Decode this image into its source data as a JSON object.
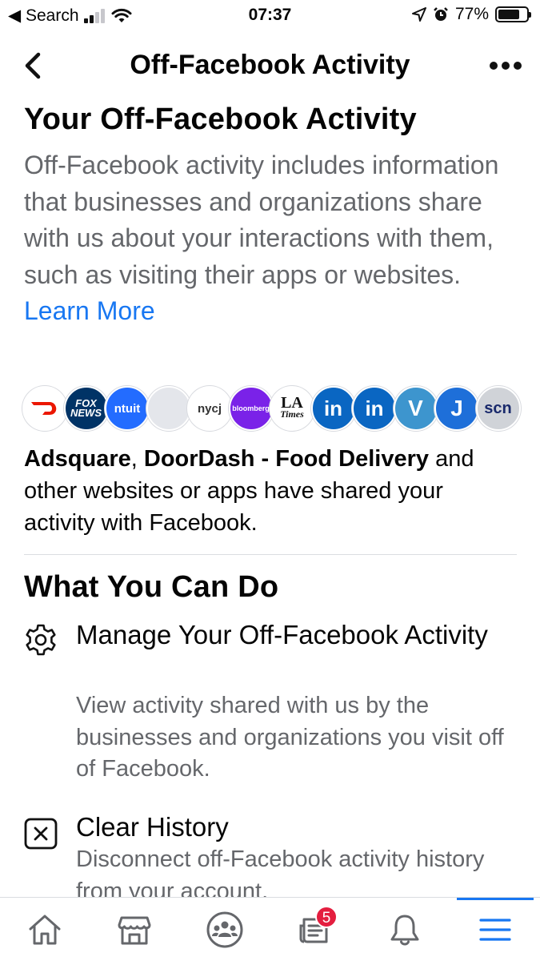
{
  "status_bar": {
    "carrier": "◀ Search",
    "time": "07:37",
    "battery_percent": "77%",
    "battery_level": 0.77
  },
  "nav": {
    "title": "Off-Facebook Activity"
  },
  "summary": {
    "title": "Your Off-Facebook Activity",
    "intro": "Off-Facebook activity includes information that businesses and organizations share with us about your interactions with them, such as visiting their apps or websites.",
    "learn_more": "Learn More",
    "logos": [
      {
        "name": "doordash-logo",
        "label": "",
        "bg": "#ffffff",
        "fg": "#eb1700"
      },
      {
        "name": "fox-news-logo",
        "label": "FOX NEWS",
        "bg": "#003366",
        "fg": "#ffffff"
      },
      {
        "name": "intuit-logo",
        "label": "ntuit",
        "bg": "#236cff",
        "fg": "#ffffff"
      },
      {
        "name": "blank-logo",
        "label": "",
        "bg": "#e4e6eb",
        "fg": "#e4e6eb"
      },
      {
        "name": "nycj-logo",
        "label": "nycj",
        "bg": "#ffffff",
        "fg": "#333333"
      },
      {
        "name": "bloomberg-logo",
        "label": "bloomberg",
        "bg": "#7a22e8",
        "fg": "#ffffff"
      },
      {
        "name": "la-times-logo",
        "label": "LA Times",
        "bg": "#ffffff",
        "fg": "#111111"
      },
      {
        "name": "linkedin-logo-1",
        "label": "in",
        "bg": "#0a66c2",
        "fg": "#ffffff"
      },
      {
        "name": "linkedin-logo-2",
        "label": "in",
        "bg": "#0a66c2",
        "fg": "#ffffff"
      },
      {
        "name": "venmo-logo",
        "label": "V",
        "bg": "#3d95ce",
        "fg": "#ffffff"
      },
      {
        "name": "j-logo",
        "label": "J",
        "bg": "#1e6fd9",
        "fg": "#ffffff"
      },
      {
        "name": "scan-logo",
        "label": "scn",
        "bg": "#d0d3d8",
        "fg": "#1a2a6c"
      }
    ],
    "shared_bold_1": "Adsquare",
    "shared_sep": ", ",
    "shared_bold_2": "DoorDash - Food Delivery",
    "shared_rest": " and other websites or apps have shared your activity with Facebook."
  },
  "actions_section": {
    "title": "What You Can Do",
    "items": [
      {
        "icon": "gear-icon",
        "title": "Manage Your Off-Facebook Activity",
        "description": "View activity shared with us by the businesses and organizations you visit off of Facebook."
      },
      {
        "icon": "close-box-icon",
        "title": "Clear History",
        "description": "Disconnect off-Facebook activity history from your account."
      }
    ]
  },
  "tab_bar": {
    "tabs": [
      {
        "icon": "home-icon"
      },
      {
        "icon": "marketplace-icon"
      },
      {
        "icon": "groups-icon"
      },
      {
        "icon": "news-icon",
        "badge": "5"
      },
      {
        "icon": "bell-icon"
      },
      {
        "icon": "menu-icon",
        "active": true
      }
    ]
  },
  "colors": {
    "accent": "#1877f2",
    "secondary_text": "#65676b",
    "badge": "#e41e3f"
  }
}
